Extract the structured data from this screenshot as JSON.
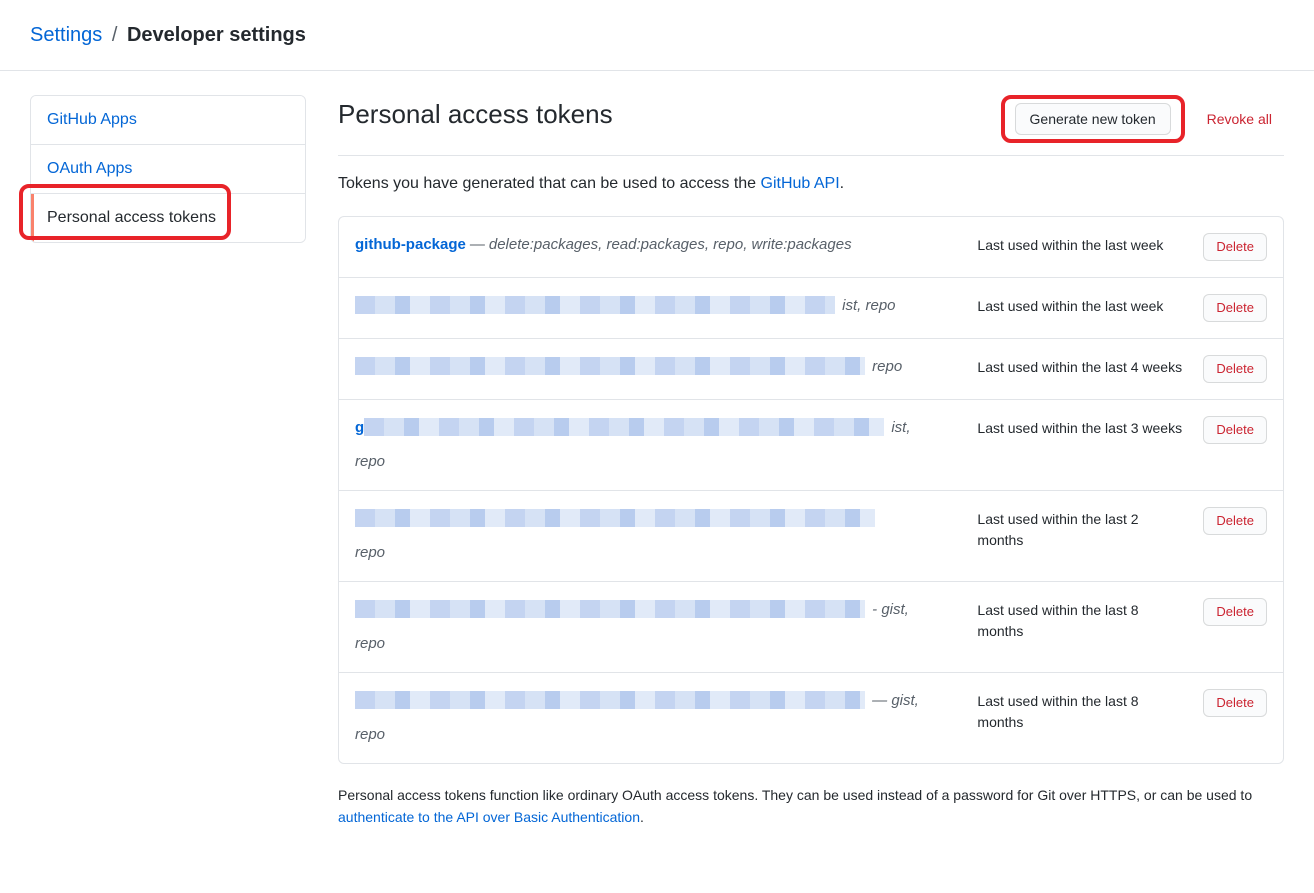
{
  "breadcrumb": {
    "root": "Settings",
    "sep": "/",
    "current": "Developer settings"
  },
  "sidebar": {
    "items": [
      {
        "label": "GitHub Apps",
        "active": false
      },
      {
        "label": "OAuth Apps",
        "active": false
      },
      {
        "label": "Personal access tokens",
        "active": true
      }
    ]
  },
  "heading": "Personal access tokens",
  "actions": {
    "generate": "Generate new token",
    "revoke": "Revoke all"
  },
  "intro": {
    "prefix": "Tokens you have generated that can be used to access the ",
    "link": "GitHub API",
    "suffix": "."
  },
  "tokens": [
    {
      "name": "github-package",
      "name_visible": true,
      "scopes_full": "delete:packages, read:packages, repo, write:packages",
      "scope_tail": "",
      "scope_wrap": "",
      "blur": false,
      "last_used": "Last used within the last week"
    },
    {
      "name": "",
      "name_visible": false,
      "scopes_full": "",
      "scope_tail": "ist, repo",
      "scope_wrap": "",
      "blur": true,
      "blur_class": "t1",
      "last_used": "Last used within the last week"
    },
    {
      "name": "",
      "name_visible": false,
      "scopes_full": "",
      "scope_tail": "repo",
      "scope_wrap": "",
      "blur": true,
      "blur_class": "t2",
      "last_used": "Last used within the last 4 weeks"
    },
    {
      "name": "g",
      "name_visible": true,
      "scopes_full": "",
      "scope_tail": "ist,",
      "scope_wrap": "repo",
      "blur": true,
      "blur_class": "t3",
      "last_used": "Last used within the last 3 weeks"
    },
    {
      "name": "",
      "name_visible": false,
      "scopes_full": "",
      "scope_tail": "",
      "scope_wrap": "repo",
      "blur": true,
      "blur_class": "t3",
      "last_used": "Last used within the last 2 months"
    },
    {
      "name": "",
      "name_visible": false,
      "scopes_full": "",
      "scope_tail": "- gist,",
      "scope_wrap": "repo",
      "blur": true,
      "blur_class": "t2",
      "last_used": "Last used within the last 8 months"
    },
    {
      "name": "",
      "name_visible": false,
      "scopes_full": "",
      "scope_tail": "— gist,",
      "scope_wrap": "repo",
      "blur": true,
      "blur_class": "t2",
      "last_used": "Last used within the last 8 months"
    }
  ],
  "delete_label": "Delete",
  "footnote": {
    "prefix": "Personal access tokens function like ordinary OAuth access tokens. They can be used instead of a password for Git over HTTPS, or can be used to ",
    "link": "authenticate to the API over Basic Authentication",
    "suffix": "."
  }
}
